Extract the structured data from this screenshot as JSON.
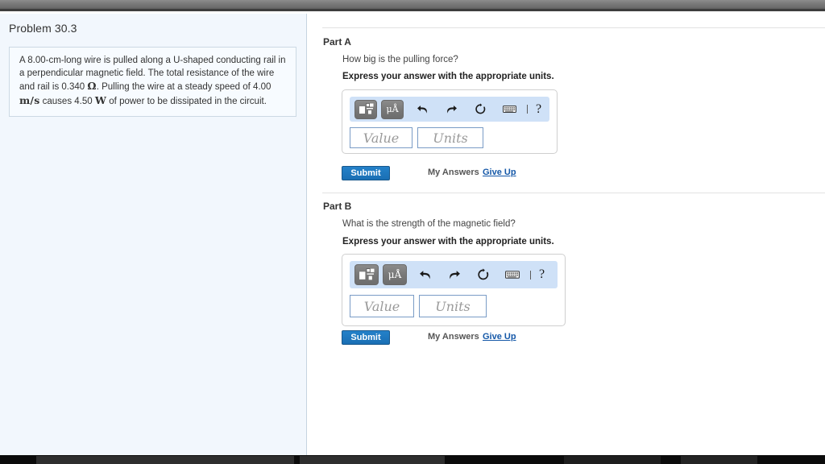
{
  "window": {
    "top_bar_color": "#787878",
    "taskbar_color": "#0b0b0b"
  },
  "problem": {
    "title": "Problem 30.3",
    "statement_parts": [
      {
        "t": "A 8.00-cm-long wire is pulled along a U-shaped conducting rail in a perpendicular magnetic field. The total resistance of the wire and rail is 0.340 ",
        "math": false
      },
      {
        "t": "Ω",
        "math": true
      },
      {
        "t": ". Pulling the wire at a steady speed of 4.00 ",
        "math": false
      },
      {
        "t": "m/s",
        "math": true
      },
      {
        "t": " causes 4.50 ",
        "math": false
      },
      {
        "t": "W",
        "math": true
      },
      {
        "t": " of power to be dissipated in the circuit.",
        "math": false
      }
    ],
    "statement_plain": "A 8.00-cm-long wire is pulled along a U-shaped conducting rail in a perpendicular magnetic field. The total resistance of the wire and rail is 0.340 Ω. Pulling the wire at a steady speed of 4.00 m/s causes 4.50 W of power to be dissipated in the circuit."
  },
  "toolbar": {
    "template_button_name": "math-template-button",
    "units_button_label": "μÅ",
    "undo_label": "undo",
    "redo_label": "redo",
    "reset_label": "reset",
    "keyboard_label": "keyboard",
    "help_label": "?",
    "background_color": "#cfe1f7"
  },
  "fields": {
    "value_placeholder": "Value",
    "units_placeholder": "Units",
    "value_current": "",
    "units_current": "",
    "border_color": "#7a9cc6"
  },
  "actions": {
    "submit_label": "Submit",
    "my_answers_label": "My Answers",
    "give_up_label": "Give Up",
    "submit_color": "#1a6fb4",
    "link_color": "#1558a8"
  },
  "parts": [
    {
      "label": "Part A",
      "question": "How big is the pulling force?",
      "instruction": "Express your answer with the appropriate units."
    },
    {
      "label": "Part B",
      "question": "What is the strength of the magnetic field?",
      "instruction": "Express your answer with the appropriate units."
    }
  ]
}
